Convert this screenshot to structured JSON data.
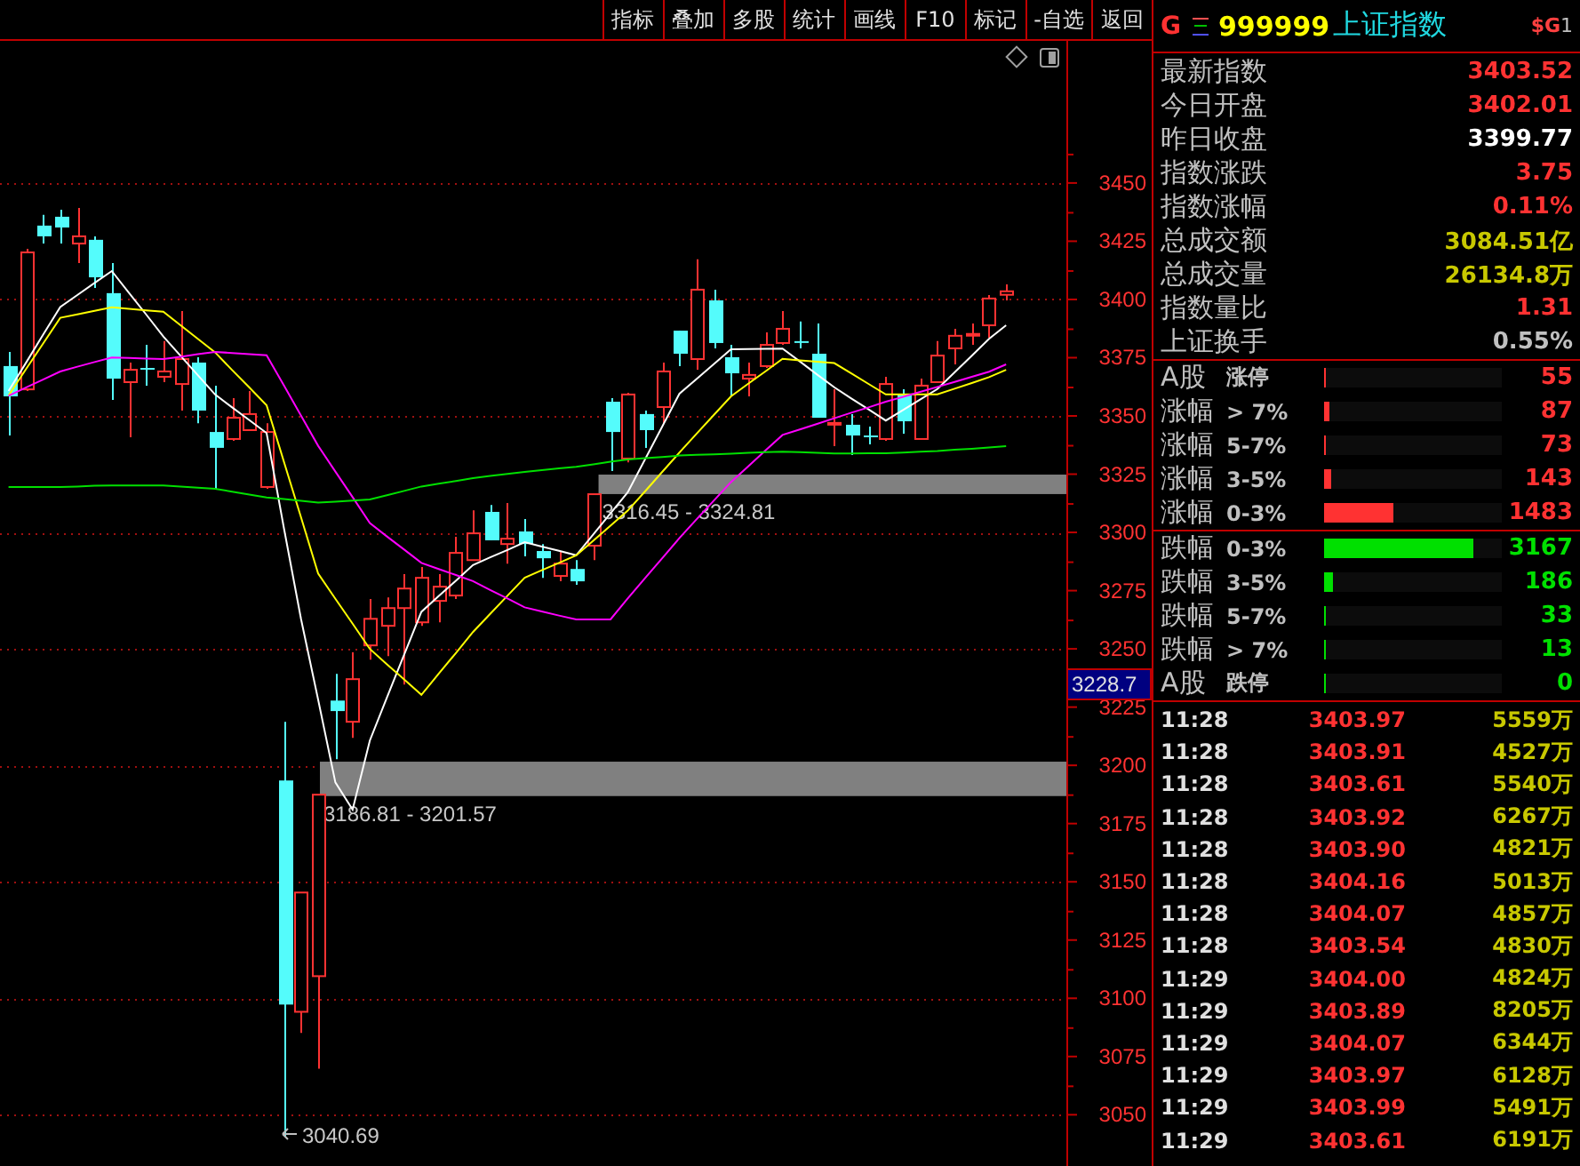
{
  "toolbar": {
    "buttons": [
      "指标",
      "叠加",
      "多股",
      "统计",
      "画线",
      "F10",
      "标记",
      "-自选",
      "返回"
    ]
  },
  "chart": {
    "chart_data": {
      "type": "candlestick",
      "grid": true,
      "categories": [
        null,
        null,
        null,
        null,
        null,
        null,
        null,
        null,
        null,
        null,
        null,
        null,
        null,
        null,
        null,
        null,
        null,
        null,
        null,
        null,
        null,
        null,
        null,
        null,
        null,
        null,
        null,
        null,
        null,
        null,
        null,
        null,
        null,
        null,
        null,
        null,
        null,
        null,
        null,
        null,
        null,
        null,
        null,
        null,
        null,
        null,
        null,
        null,
        null,
        null,
        null,
        null,
        null,
        null,
        null,
        null,
        null,
        null,
        null,
        null,
        null,
        null
      ],
      "ylim": [
        3028,
        3511
      ],
      "yticks": [
        {
          "value": 3450,
          "label": "3450"
        },
        {
          "value": 3425,
          "label": "3425"
        },
        {
          "value": 3400,
          "label": "3400"
        },
        {
          "value": 3375,
          "label": "3375"
        },
        {
          "value": 3350,
          "label": "3350"
        },
        {
          "value": 3325,
          "label": "3325"
        },
        {
          "value": 3300,
          "label": "3300"
        },
        {
          "value": 3275,
          "label": "3275"
        },
        {
          "value": 3250,
          "label": "3250"
        },
        {
          "value": 3225,
          "label": "3225"
        },
        {
          "value": 3200,
          "label": "3200"
        },
        {
          "value": 3175,
          "label": "3175"
        },
        {
          "value": 3150,
          "label": "3150"
        },
        {
          "value": 3125,
          "label": "3125"
        },
        {
          "value": 3100,
          "label": "3100"
        },
        {
          "value": 3075,
          "label": "3075"
        },
        {
          "value": 3050,
          "label": "3050"
        }
      ],
      "ohlc": [
        [
          3371.4,
          3377.5,
          3341.6,
          3358.4
        ],
        [
          3361.4,
          3421.7,
          3360.7,
          3420.2
        ],
        [
          3431.7,
          3436.3,
          3424.0,
          3427.1
        ],
        [
          3435.5,
          3438.5,
          3424.0,
          3430.9
        ],
        [
          3424.0,
          3439.3,
          3415.6,
          3427.1
        ],
        [
          3425.6,
          3427.1,
          3404.9,
          3409.5
        ],
        [
          3402.7,
          3415.6,
          3356.9,
          3366.0
        ],
        [
          3364.5,
          3372.9,
          3340.8,
          3369.8
        ],
        [
          3370.6,
          3380.5,
          3363.0,
          3370.5
        ],
        [
          3366.8,
          3382.1,
          3364.5,
          3369.1
        ],
        [
          3363.7,
          3395.0,
          3352.3,
          3374.4
        ],
        [
          3372.9,
          3375.2,
          3346.9,
          3352.3
        ],
        [
          3343.1,
          3363.0,
          3318.7,
          3336.3
        ],
        [
          3340.1,
          3357.6,
          3339.3,
          3349.2
        ],
        [
          3343.9,
          3360.7,
          3343.9,
          3350.8
        ],
        [
          3319.5,
          3346.9,
          3318.7,
          3343.1
        ],
        [
          3193.5,
          3218.7,
          3040.7,
          3097.3
        ],
        [
          3094.2,
          3145.4,
          3085.1,
          3145.4
        ],
        [
          3109.5,
          3187.4,
          3069.8,
          3187.4
        ],
        [
          3227.8,
          3239.3,
          3202.6,
          3223.3
        ],
        [
          3218.7,
          3248.5,
          3211.8,
          3237.0
        ],
        [
          3251.5,
          3271.4,
          3245.4,
          3262.9
        ],
        [
          3259.9,
          3272.1,
          3246.9,
          3267.5
        ],
        [
          3267.5,
          3282.1,
          3234.7,
          3275.9
        ],
        [
          3261.4,
          3285.1,
          3259.9,
          3280.5
        ],
        [
          3270.6,
          3282.1,
          3261.4,
          3276.7
        ],
        [
          3272.9,
          3298.1,
          3271.4,
          3291.2
        ],
        [
          3288.1,
          3309.5,
          3288.1,
          3299.6
        ],
        [
          3308.8,
          3311.8,
          3296.6,
          3296.6
        ],
        [
          3295.0,
          3312.6,
          3286.6,
          3297.3
        ],
        [
          3300.4,
          3305.7,
          3289.7,
          3295.0
        ],
        [
          3292.0,
          3295.0,
          3280.5,
          3288.9
        ],
        [
          3281.3,
          3292.0,
          3279.0,
          3286.6
        ],
        [
          3284.3,
          3288.1,
          3277.5,
          3279.0
        ],
        [
          3294.3,
          3316.4,
          3288.1,
          3316.4
        ],
        [
          3356.1,
          3357.6,
          3326.3,
          3343.1
        ],
        [
          3331.7,
          3359.9,
          3330.1,
          3359.2
        ],
        [
          3350.8,
          3352.3,
          3336.3,
          3343.9
        ],
        [
          3353.8,
          3372.9,
          3346.9,
          3369.1
        ],
        [
          3386.6,
          3386.6,
          3371.4,
          3376.7
        ],
        [
          3374.4,
          3417.2,
          3369.8,
          3404.2
        ],
        [
          3399.6,
          3404.2,
          3379.0,
          3381.3
        ],
        [
          3375.2,
          3380.5,
          3358.4,
          3368.3
        ],
        [
          3366.0,
          3372.9,
          3358.4,
          3367.6
        ],
        [
          3371.4,
          3385.9,
          3370.6,
          3380.5
        ],
        [
          3381.3,
          3395.0,
          3380.5,
          3387.4
        ],
        [
          3382.1,
          3390.5,
          3379.0,
          3382.0
        ],
        [
          3376.7,
          3389.7,
          3349.2,
          3349.2
        ],
        [
          3346.9,
          3361.4,
          3337.0,
          3347.0
        ],
        [
          3346.2,
          3350.8,
          3333.2,
          3341.6
        ],
        [
          3341.6,
          3345.4,
          3337.8,
          3341.5
        ],
        [
          3340.1,
          3366.8,
          3339.3,
          3363.7
        ],
        [
          3359.2,
          3361.4,
          3342.4,
          3347.7
        ],
        [
          3340.1,
          3366.0,
          3340.1,
          3363.0
        ],
        [
          3364.5,
          3382.1,
          3364.5,
          3375.9
        ],
        [
          3379.0,
          3387.4,
          3372.1,
          3384.4
        ],
        [
          3385.1,
          3389.7,
          3380.5,
          3385.2
        ],
        [
          3388.9,
          3401.9,
          3383.6,
          3400.4
        ],
        [
          3402.0,
          3406.5,
          3399.6,
          3403.5
        ],
        null,
        null,
        null
      ],
      "series": [
        {
          "type": "line",
          "color": "#ffffff",
          "values": [
            3360.7,
            3372.7,
            3384.8,
            3396.8,
            3401.9,
            3407.1,
            3412.2,
            3402.8,
            3393.5,
            3384.1,
            3375.8,
            3367.5,
            3359.2,
            3353.7,
            3348.2,
            3342.7,
            3302.0,
            3262.7,
            3228.2,
            3192.7,
            3181.0,
            3210.7,
            3229.1,
            3247.5,
            3265.9,
            3272.6,
            3279.3,
            3286.0,
            3289.3,
            3292.5,
            3295.8,
            3293.9,
            3292.1,
            3290.2,
            3299.2,
            3308.2,
            3317.2,
            3331.3,
            3345.4,
            3359.5,
            3365.9,
            3372.2,
            3378.6,
            3378.7,
            3378.8,
            3378.9,
            3373.4,
            3367.8,
            3362.3,
            3357.5,
            3352.8,
            3348.0,
            3352.5,
            3357.0,
            3361.5,
            3368.7,
            3375.9,
            3383.1,
            3388.9,
            null,
            null,
            null
          ]
        },
        {
          "type": "line",
          "color": "#ffff00",
          "values": [
            3358.8,
            3369.9,
            3381.0,
            3392.1,
            3393.6,
            3395.1,
            3396.6,
            3396.0,
            3395.3,
            3394.7,
            3388.9,
            3383.1,
            3377.3,
            3369.7,
            3362.2,
            3354.6,
            3330.5,
            3306.4,
            3282.3,
            3271.5,
            3260.8,
            3250.0,
            3243.4,
            3236.9,
            3230.3,
            3239.3,
            3248.2,
            3257.2,
            3265.0,
            3272.8,
            3280.6,
            3283.8,
            3286.9,
            3290.1,
            3296.5,
            3302.9,
            3309.3,
            3317.6,
            3326.0,
            3334.3,
            3342.3,
            3350.4,
            3358.4,
            3363.8,
            3369.1,
            3374.5,
            3373.9,
            3373.3,
            3372.7,
            3368.2,
            3363.7,
            3359.2,
            3359.2,
            3359.2,
            3359.2,
            3361.7,
            3364.1,
            3366.6,
            3369.8,
            null,
            null,
            null
          ]
        },
        {
          "type": "line",
          "color": "#ff00ff",
          "values": [
            3358.6,
            3362.1,
            3365.6,
            3369.1,
            3371.1,
            3373.1,
            3375.1,
            3374.9,
            3374.6,
            3374.4,
            3375.4,
            3376.5,
            3377.5,
            3377.0,
            3376.5,
            3376.0,
            3363.1,
            3350.1,
            3337.2,
            3326.1,
            3315.1,
            3304.0,
            3298.3,
            3292.6,
            3286.9,
            3284.3,
            3281.7,
            3279.1,
            3275.3,
            3271.6,
            3267.8,
            3266.1,
            3264.3,
            3262.6,
            3262.6,
            3262.6,
            3271.6,
            3280.3,
            3288.9,
            3297.6,
            3305.6,
            3313.6,
            3321.6,
            3328.3,
            3335.1,
            3341.8,
            3344.2,
            3346.6,
            3349.0,
            3351.4,
            3353.7,
            3356.1,
            3358.2,
            3360.3,
            3362.4,
            3364.6,
            3366.8,
            3369.0,
            3372.1,
            null,
            null,
            null
          ]
        },
        {
          "type": "line",
          "color": "#00e000",
          "values": [
            3319.5,
            3319.5,
            3319.5,
            3319.5,
            3319.7,
            3320.0,
            3320.2,
            3320.2,
            3320.2,
            3320.2,
            3319.7,
            3319.2,
            3318.7,
            3317.5,
            3316.2,
            3315.0,
            3314.3,
            3313.5,
            3312.8,
            3313.2,
            3313.7,
            3314.1,
            3316.0,
            3317.8,
            3319.7,
            3320.9,
            3322.1,
            3323.3,
            3324.2,
            3325.1,
            3326.0,
            3326.7,
            3327.5,
            3328.2,
            3329.2,
            3330.3,
            3331.3,
            3331.9,
            3332.4,
            3333.0,
            3333.3,
            3333.5,
            3333.8,
            3334.1,
            3334.4,
            3334.7,
            3334.4,
            3334.2,
            3333.9,
            3333.9,
            3334.0,
            3334.0,
            3334.3,
            3334.7,
            3335.0,
            3335.5,
            3335.9,
            3336.4,
            3337.0,
            null,
            null,
            null
          ]
        }
      ],
      "bands": [
        {
          "axis": "y",
          "from": 3316.45,
          "to": 3324.81,
          "label": "3316.45 - 3324.81"
        },
        {
          "axis": "y",
          "from": 3186.81,
          "to": 3201.57,
          "label": "3186.81 - 3201.57"
        }
      ]
    },
    "current_price": "3228.7",
    "low_marker": "3040.69"
  },
  "quote": {
    "market_letter": "G",
    "code": "999999",
    "name": "上证指数",
    "badge": "$G",
    "badge_suffix": "1",
    "stats": [
      {
        "label": "最新指数",
        "value": "3403.52",
        "color": "#ff3232"
      },
      {
        "label": "今日开盘",
        "value": "3402.01",
        "color": "#ff3232"
      },
      {
        "label": "昨日收盘",
        "value": "3399.77",
        "color": "#ffffff"
      },
      {
        "label": "指数涨跌",
        "value": "3.75",
        "color": "#ff3232"
      },
      {
        "label": "指数涨幅",
        "value": "0.11%",
        "color": "#ff3232"
      },
      {
        "label": "总成交额",
        "value": "3084.51亿",
        "color": "#c8c800"
      },
      {
        "label": "总成交量",
        "value": "26134.8万",
        "color": "#c8c800"
      },
      {
        "label": "指数量比",
        "value": "1.31",
        "color": "#ff3232"
      },
      {
        "label": "上证换手",
        "value": "0.55%",
        "color": "#c0c0c0"
      }
    ]
  },
  "breadth": {
    "rising": [
      {
        "name": "A股",
        "range": "涨停",
        "count": "55",
        "level": 0.01,
        "color": "#ff3232"
      },
      {
        "name": "涨幅",
        "range": "> 7%",
        "count": "87",
        "level": 0.03,
        "color": "#ff3232"
      },
      {
        "name": "涨幅",
        "range": "5-7%",
        "count": "73",
        "level": 0.01,
        "color": "#ff3232"
      },
      {
        "name": "涨幅",
        "range": "3-5%",
        "count": "143",
        "level": 0.04,
        "color": "#ff3232"
      },
      {
        "name": "涨幅",
        "range": "0-3%",
        "count": "1483",
        "level": 0.39,
        "color": "#ff3232"
      }
    ],
    "falling": [
      {
        "name": "跌幅",
        "range": "0-3%",
        "count": "3167",
        "level": 0.84,
        "color": "#00e000"
      },
      {
        "name": "跌幅",
        "range": "3-5%",
        "count": "186",
        "level": 0.05,
        "color": "#00e000"
      },
      {
        "name": "跌幅",
        "range": "5-7%",
        "count": "33",
        "level": 0.01,
        "color": "#00e000"
      },
      {
        "name": "跌幅",
        "range": "> 7%",
        "count": "13",
        "level": 0.01,
        "color": "#00e000"
      },
      {
        "name": "A股",
        "range": "跌停",
        "count": "0",
        "level": 0.01,
        "color": "#00e000"
      }
    ]
  },
  "ticks": [
    {
      "time": "11:28",
      "price": "3403.97",
      "volume": "5559万"
    },
    {
      "time": "11:28",
      "price": "3403.91",
      "volume": "4527万"
    },
    {
      "time": "11:28",
      "price": "3403.61",
      "volume": "5540万"
    },
    {
      "time": "11:28",
      "price": "3403.92",
      "volume": "6267万"
    },
    {
      "time": "11:28",
      "price": "3403.90",
      "volume": "4821万"
    },
    {
      "time": "11:28",
      "price": "3404.16",
      "volume": "5013万"
    },
    {
      "time": "11:28",
      "price": "3404.07",
      "volume": "4857万"
    },
    {
      "time": "11:28",
      "price": "3403.54",
      "volume": "4830万"
    },
    {
      "time": "11:29",
      "price": "3404.00",
      "volume": "4824万"
    },
    {
      "time": "11:29",
      "price": "3403.89",
      "volume": "8205万"
    },
    {
      "time": "11:29",
      "price": "3404.07",
      "volume": "6344万"
    },
    {
      "time": "11:29",
      "price": "3403.97",
      "volume": "6128万"
    },
    {
      "time": "11:29",
      "price": "3403.99",
      "volume": "5491万"
    },
    {
      "time": "11:29",
      "price": "3403.61",
      "volume": "6191万"
    }
  ]
}
